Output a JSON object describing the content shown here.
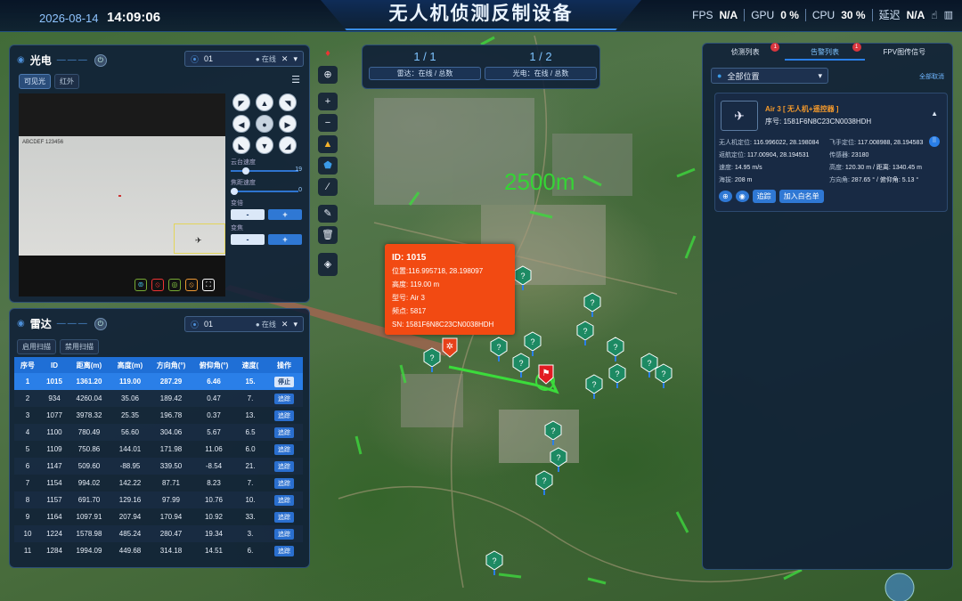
{
  "header": {
    "date": "2026-08-14",
    "time": "14:09:06",
    "title": "无人机侦测反制设备",
    "fps_label": "FPS",
    "fps": "N/A",
    "gpu_label": "GPU",
    "gpu": "0 %",
    "cpu_label": "CPU",
    "cpu": "30 %",
    "latency_label": "延迟",
    "latency": "N/A"
  },
  "optical": {
    "title": "光电",
    "device": "01",
    "status": "● 在线",
    "tabs": [
      "可见光",
      "红外"
    ],
    "video_overlay": "ABCDEF 123456",
    "slider1_label": "云台速度",
    "slider1_value": "19",
    "slider1_level": 0.19,
    "slider2_label": "焦距速度",
    "slider2_value": "0",
    "slider2_level": 0,
    "zoom_label": "变倍",
    "focus_label": "变焦",
    "minus": "-",
    "plus": "+"
  },
  "radar": {
    "title": "雷达",
    "device": "01",
    "status": "● 在线",
    "tabs": [
      "启用扫描",
      "禁用扫描"
    ],
    "columns": [
      "序号",
      "ID",
      "距离(m)",
      "高度(m)",
      "方向角(°)",
      "俯仰角(°)",
      "速度(",
      "操作"
    ],
    "rows": [
      [
        "1",
        "1015",
        "1361.20",
        "119.00",
        "287.29",
        "6.46",
        "15.",
        "停止"
      ],
      [
        "2",
        "934",
        "4260.04",
        "35.06",
        "189.42",
        "0.47",
        "7.",
        "追踪"
      ],
      [
        "3",
        "1077",
        "3978.32",
        "25.35",
        "196.78",
        "0.37",
        "13.",
        "追踪"
      ],
      [
        "4",
        "1100",
        "780.49",
        "56.60",
        "304.06",
        "5.67",
        "6.5",
        "追踪"
      ],
      [
        "5",
        "1109",
        "750.86",
        "144.01",
        "171.98",
        "11.06",
        "6.0",
        "追踪"
      ],
      [
        "6",
        "1147",
        "509.60",
        "-88.95",
        "339.50",
        "-8.54",
        "21.",
        "追踪"
      ],
      [
        "7",
        "1154",
        "994.02",
        "142.22",
        "87.71",
        "8.23",
        "7.",
        "追踪"
      ],
      [
        "8",
        "1157",
        "691.70",
        "129.16",
        "97.99",
        "10.76",
        "10.",
        "追踪"
      ],
      [
        "9",
        "1164",
        "1097.91",
        "207.94",
        "170.94",
        "10.92",
        "33.",
        "追踪"
      ],
      [
        "10",
        "1224",
        "1578.98",
        "485.24",
        "280.47",
        "19.34",
        "3.",
        "追踪"
      ],
      [
        "11",
        "1284",
        "1994.09",
        "449.68",
        "314.18",
        "14.51",
        "6.",
        "追踪"
      ]
    ]
  },
  "map": {
    "ring_label": "2500m",
    "radar_stat": "1 / 1",
    "radar_caption": "雷达：在线 / 总数",
    "optic_stat": "1 / 2",
    "optic_caption": "光电：在线 / 总数",
    "pin_mark": "?",
    "popup": {
      "id": "ID: 1015",
      "position": "位置:116.995718, 28.198097",
      "height": "高度: 119.00 m",
      "model": "型号: Air 3",
      "freq": "频点: 5817",
      "sn": "SN: 1581F6N8C23CN0038HDH"
    }
  },
  "right": {
    "tabs": [
      "侦测列表",
      "告警列表",
      "FPV图传信号"
    ],
    "badges": [
      "1",
      "1"
    ],
    "location_select": "全部位置",
    "clear_all": "全部取消",
    "drone": {
      "name": "Air 3 [ 无人机+遥控器 ]",
      "serial_label": "序号:",
      "serial": "1581F6N8C23CN0038HDH",
      "drone_pos_label": "无人机定位:",
      "drone_pos": "116.996022, 28.198084",
      "pilot_pos_label": "飞手定位:",
      "pilot_pos": "117.008988, 28.194583",
      "home_pos_label": "返航定位:",
      "home_pos": "117.00904, 28.194531",
      "freq_label": "传感器:",
      "freq": "23180",
      "speed_label": "速度:",
      "speed": "14.95 m/s",
      "altitude_label": "高度:",
      "altitude": "120.30 m / 距离: 1340.45 m",
      "sea_label": "海拔:",
      "sea": "208 m",
      "heading_label": "方向角:",
      "heading": "287.65 ° / 俯仰角: 5.13 °",
      "btn_track": "追踪",
      "btn_whitelist": "加入白名单"
    }
  },
  "colors": {
    "accent": "#2a7fe8",
    "alert": "#f24a12",
    "pin": "#1d8a63",
    "panel": "#0e1e37"
  }
}
